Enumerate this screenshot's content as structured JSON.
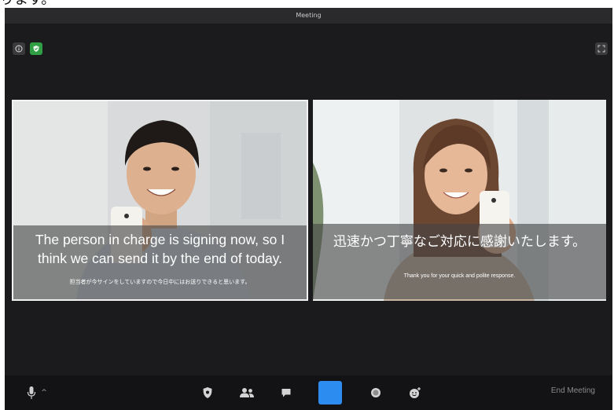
{
  "header_caption": "ります。",
  "window": {
    "title": "Meeting"
  },
  "top_controls": {
    "info_icon": "info-icon",
    "security_icon": "shield-check-icon",
    "fullscreen_icon": "fullscreen-icon",
    "shield_color": "#2f9e44"
  },
  "videos": [
    {
      "main_caption": "The person in charge is signing now, so I think we can send it by the end of today.",
      "sub_caption": "担当者が今サインをしていますので今日中にはお送りできると思います。"
    },
    {
      "main_caption": "迅速かつ丁寧なご対応に感謝いたします。",
      "sub_caption": "Thank you for your quick and polite response."
    }
  ],
  "toolbar": {
    "mic_icon": "microphone-icon",
    "mic_caret": "^",
    "security_icon": "shield-icon",
    "participants_icon": "participants-icon",
    "chat_icon": "chat-icon",
    "share_icon": "share-screen-icon",
    "share_color": "#2d8cf0",
    "record_icon": "record-icon",
    "reactions_icon": "reactions-icon",
    "end_label": "End Meeting"
  }
}
